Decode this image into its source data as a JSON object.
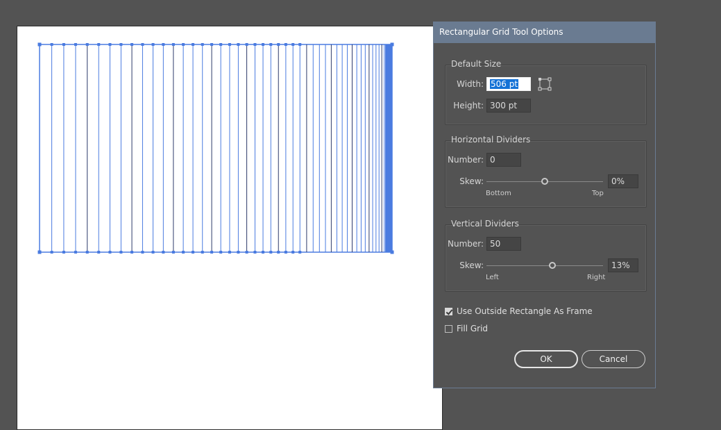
{
  "dialog": {
    "title": "Rectangular Grid Tool Options",
    "default_size": {
      "title": "Default Size",
      "width_label": "Width:",
      "width_value": "506 pt",
      "height_label": "Height:",
      "height_value": "300 pt",
      "reference_icon": "reference-point-icon"
    },
    "horizontal_dividers": {
      "title": "Horizontal Dividers",
      "number_label": "Number:",
      "number_value": "0",
      "skew_label": "Skew:",
      "skew_value": "0%",
      "skew_level": 0,
      "left_caption": "Bottom",
      "right_caption": "Top"
    },
    "vertical_dividers": {
      "title": "Vertical Dividers",
      "number_label": "Number:",
      "number_value": "50",
      "skew_label": "Skew:",
      "skew_value": "13%",
      "skew_level": 13,
      "left_caption": "Left",
      "right_caption": "Right"
    },
    "use_outside_frame": {
      "label": "Use Outside Rectangle As Frame",
      "checked": true
    },
    "fill_grid": {
      "label": "Fill Grid",
      "checked": false
    },
    "ok_label": "OK",
    "cancel_label": "Cancel"
  },
  "canvas": {
    "grid_color": "#4a7be0",
    "vertical_divider_count": 50
  }
}
